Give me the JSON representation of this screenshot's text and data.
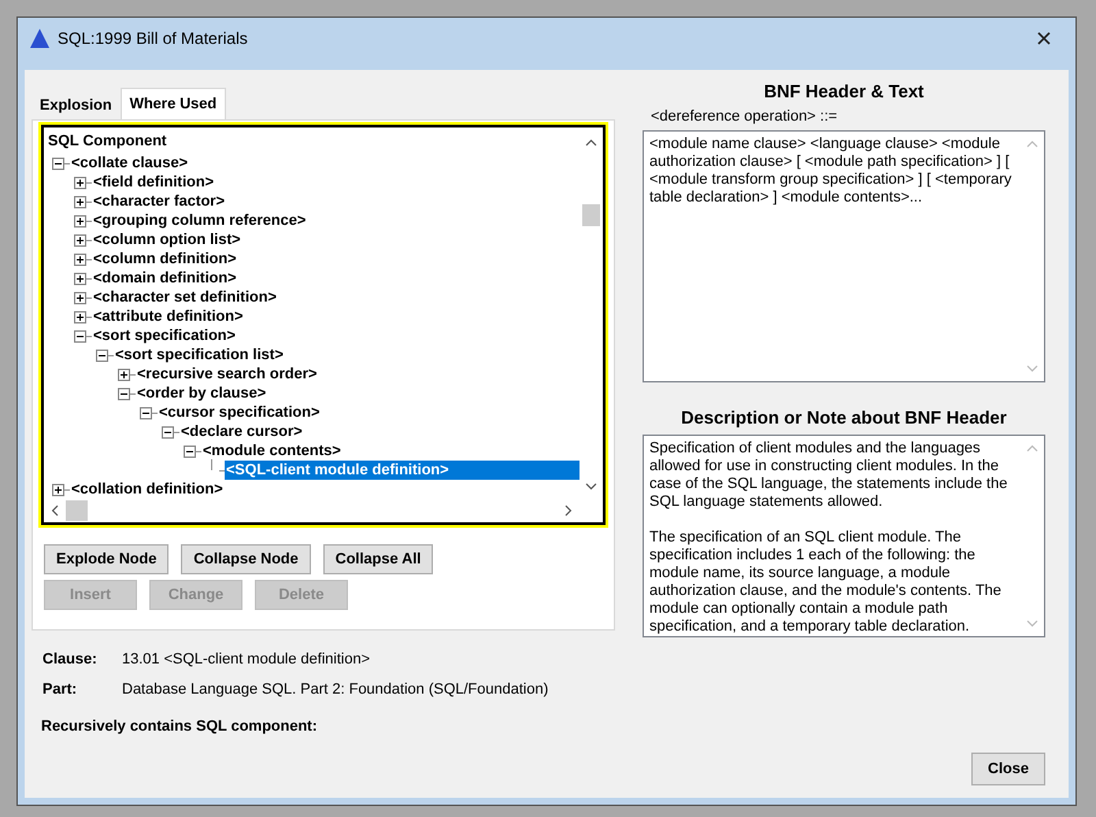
{
  "window": {
    "title": "SQL:1999 Bill of Materials"
  },
  "tabs": [
    {
      "label": "Explosion",
      "selected": false
    },
    {
      "label": "Where Used",
      "selected": true
    }
  ],
  "tree": {
    "header": "SQL Component",
    "nodes": [
      {
        "label": "<collate clause>",
        "expanded": true,
        "selected": false,
        "children": [
          {
            "label": "<field definition>",
            "expanded": false,
            "selected": false
          },
          {
            "label": "<character factor>",
            "expanded": false,
            "selected": false
          },
          {
            "label": "<grouping column reference>",
            "expanded": false,
            "selected": false
          },
          {
            "label": "<column option list>",
            "expanded": false,
            "selected": false
          },
          {
            "label": "<column definition>",
            "expanded": false,
            "selected": false
          },
          {
            "label": "<domain definition>",
            "expanded": false,
            "selected": false
          },
          {
            "label": "<character set definition>",
            "expanded": false,
            "selected": false
          },
          {
            "label": "<attribute definition>",
            "expanded": false,
            "selected": false
          },
          {
            "label": "<sort specification>",
            "expanded": true,
            "selected": false,
            "children": [
              {
                "label": "<sort specification list>",
                "expanded": true,
                "selected": false,
                "children": [
                  {
                    "label": "<recursive search order>",
                    "expanded": false,
                    "selected": false
                  },
                  {
                    "label": "<order by clause>",
                    "expanded": true,
                    "selected": false,
                    "children": [
                      {
                        "label": "<cursor specification>",
                        "expanded": true,
                        "selected": false,
                        "children": [
                          {
                            "label": "<declare cursor>",
                            "expanded": true,
                            "selected": false,
                            "children": [
                              {
                                "label": "<module contents>",
                                "expanded": true,
                                "selected": false,
                                "children": [
                                  {
                                    "label": "<SQL-client module definition>",
                                    "selected": true
                                  }
                                ]
                              }
                            ]
                          }
                        ]
                      }
                    ]
                  }
                ]
              }
            ]
          }
        ]
      },
      {
        "label": "<collation definition>",
        "expanded": false,
        "selected": false
      }
    ]
  },
  "tree_buttons": [
    {
      "label": "Explode Node",
      "disabled": false
    },
    {
      "label": "Collapse Node",
      "disabled": false
    },
    {
      "label": "Collapse All",
      "disabled": false
    }
  ],
  "edit_buttons": [
    {
      "label": "Insert",
      "disabled": true
    },
    {
      "label": "Change",
      "disabled": true
    },
    {
      "label": "Delete",
      "disabled": true
    }
  ],
  "details": [
    {
      "label": "Clause:",
      "value": "13.01 <SQL-client module definition>"
    },
    {
      "label": "Part:",
      "value": "Database Language SQL. Part 2: Foundation (SQL/Foundation)"
    }
  ],
  "recursive_label": "Recursively contains SQL component:",
  "bnf": {
    "title": "BNF Header & Text",
    "header": "<dereference operation> ::=",
    "text": "<module name clause> <language clause> <module authorization clause> [ <module path specification> ] [ <module transform group specification> ] [ <temporary table declaration> ] <module contents>..."
  },
  "description": {
    "title": "Description or Note about BNF Header",
    "paragraphs": [
      "Specification of client modules and the languages allowed for use in constructing client modules. In the case of the SQL language, the statements include the SQL language statements allowed.",
      "The specification of an SQL client module. The specification includes 1 each of the following: the module name, its source language, a module authorization clause, and the module's contents. The module can optionally contain a module path specification, and a temporary table declaration."
    ]
  },
  "close_button": {
    "label": "Close"
  }
}
